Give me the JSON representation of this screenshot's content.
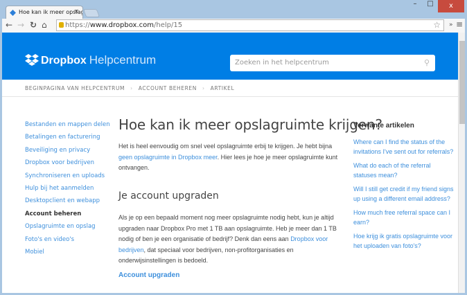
{
  "browser": {
    "tab_title": "Hoe kan ik meer opslagru",
    "url_scheme": "https://",
    "url_host": "www.dropbox.com",
    "url_path": "/help/15",
    "minimize": "–",
    "maximize": "□",
    "close": "x"
  },
  "header": {
    "brand": "Dropbox",
    "subtitle": "Helpcentrum",
    "search_placeholder": "Zoeken in het helpcentrum"
  },
  "breadcrumb": [
    "BEGINPAGINA VAN HELPCENTRUM",
    "ACCOUNT BEHEREN",
    "ARTIKEL"
  ],
  "sidebar": {
    "items": [
      {
        "label": "Bestanden en mappen delen"
      },
      {
        "label": "Betalingen en facturering"
      },
      {
        "label": "Beveiliging en privacy"
      },
      {
        "label": "Dropbox voor bedrijven"
      },
      {
        "label": "Synchroniseren en uploads"
      },
      {
        "label": "Hulp bij het aanmelden"
      },
      {
        "label": "Desktopclient en webapp"
      },
      {
        "label": "Account beheren",
        "active": true
      },
      {
        "label": "Opslagruimte en opslag"
      },
      {
        "label": "Foto's en video's"
      },
      {
        "label": "Mobiel"
      }
    ]
  },
  "article": {
    "title": "Hoe kan ik meer opslagruimte krijgen?",
    "intro_1": "Het is heel eenvoudig om snel veel opslagruimte erbij te krijgen. Je hebt bijna ",
    "intro_link": "geen opslagruimte in Dropbox meer",
    "intro_2": ". Hier lees je hoe je meer opslagruimte kunt ontvangen.",
    "section_title": "Je account upgraden",
    "body_1": "Als je op een bepaald moment nog meer opslagruimte nodig hebt, kun je altijd upgraden naar Dropbox Pro met 1 TB aan opslagruimte. Heb je meer dan 1 TB nodig of ben je een organisatie of bedrijf? Denk dan eens aan ",
    "body_link": "Dropbox voor bedrijven",
    "body_2": ", dat speciaal voor bedrijven, non-profitorganisaties en onderwijsinstellingen is bedoeld.",
    "cta": "Account upgraden"
  },
  "related": {
    "title": "Verwante artikelen",
    "items": [
      "Where can I find the status of the invitations I've sent out for referrals?",
      "What do each of the referral statuses mean?",
      "Will I still get credit if my friend signs up using a different email address?",
      "How much free referral space can I earn?",
      "Hoe krijg ik gratis opslagruimte voor het uploaden van foto's?"
    ]
  },
  "colors": {
    "brand": "#007ee5",
    "link": "#3d8fdc"
  }
}
